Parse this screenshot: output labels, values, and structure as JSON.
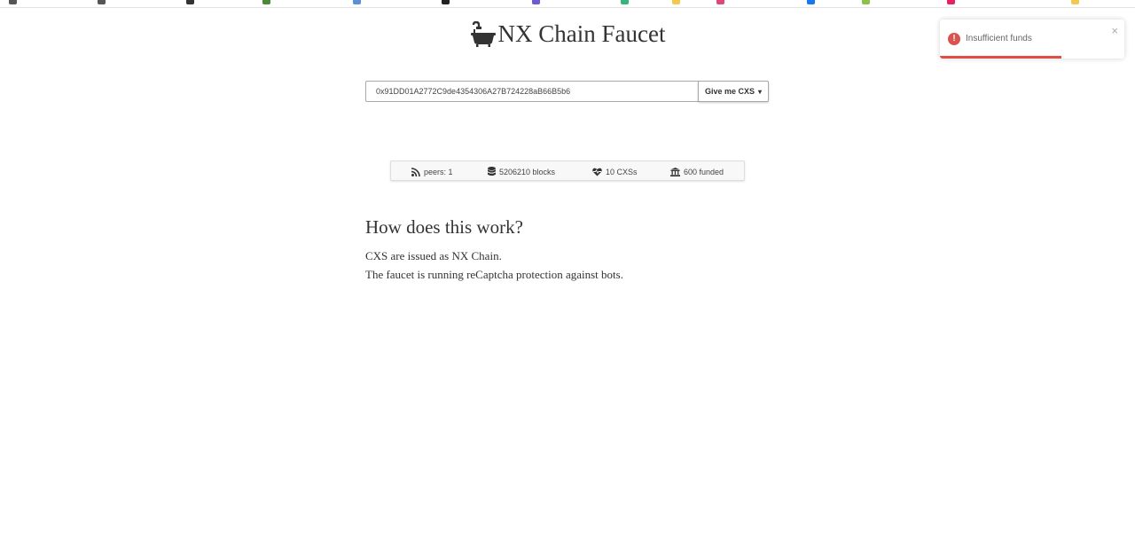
{
  "page": {
    "title": "NX Chain Faucet",
    "title_icon": "bathtub-icon"
  },
  "toast": {
    "message": "Insufficient funds",
    "close_glyph": "×",
    "progress": 0.66,
    "type": "error",
    "icon": "error-icon",
    "icon_glyph": "!",
    "accent_color": "#e34b45"
  },
  "form": {
    "address_value": "0x91DD01A2772C9de4354306A27B724228aB66B5b6",
    "button_label": "Give me CXS",
    "button_caret": "▾"
  },
  "stats": {
    "peers": "peers: 1",
    "blocks": "5206210 blocks",
    "cxs": "10 CXSs",
    "funded": "600 funded",
    "icons": [
      "rss-icon",
      "database-icon",
      "heartbeat-icon",
      "bank-icon"
    ]
  },
  "info": {
    "heading": "How does this work?",
    "line1": "CXS are issued as NX Chain.",
    "line2": "The faucet is running reCaptcha protection against bots."
  }
}
